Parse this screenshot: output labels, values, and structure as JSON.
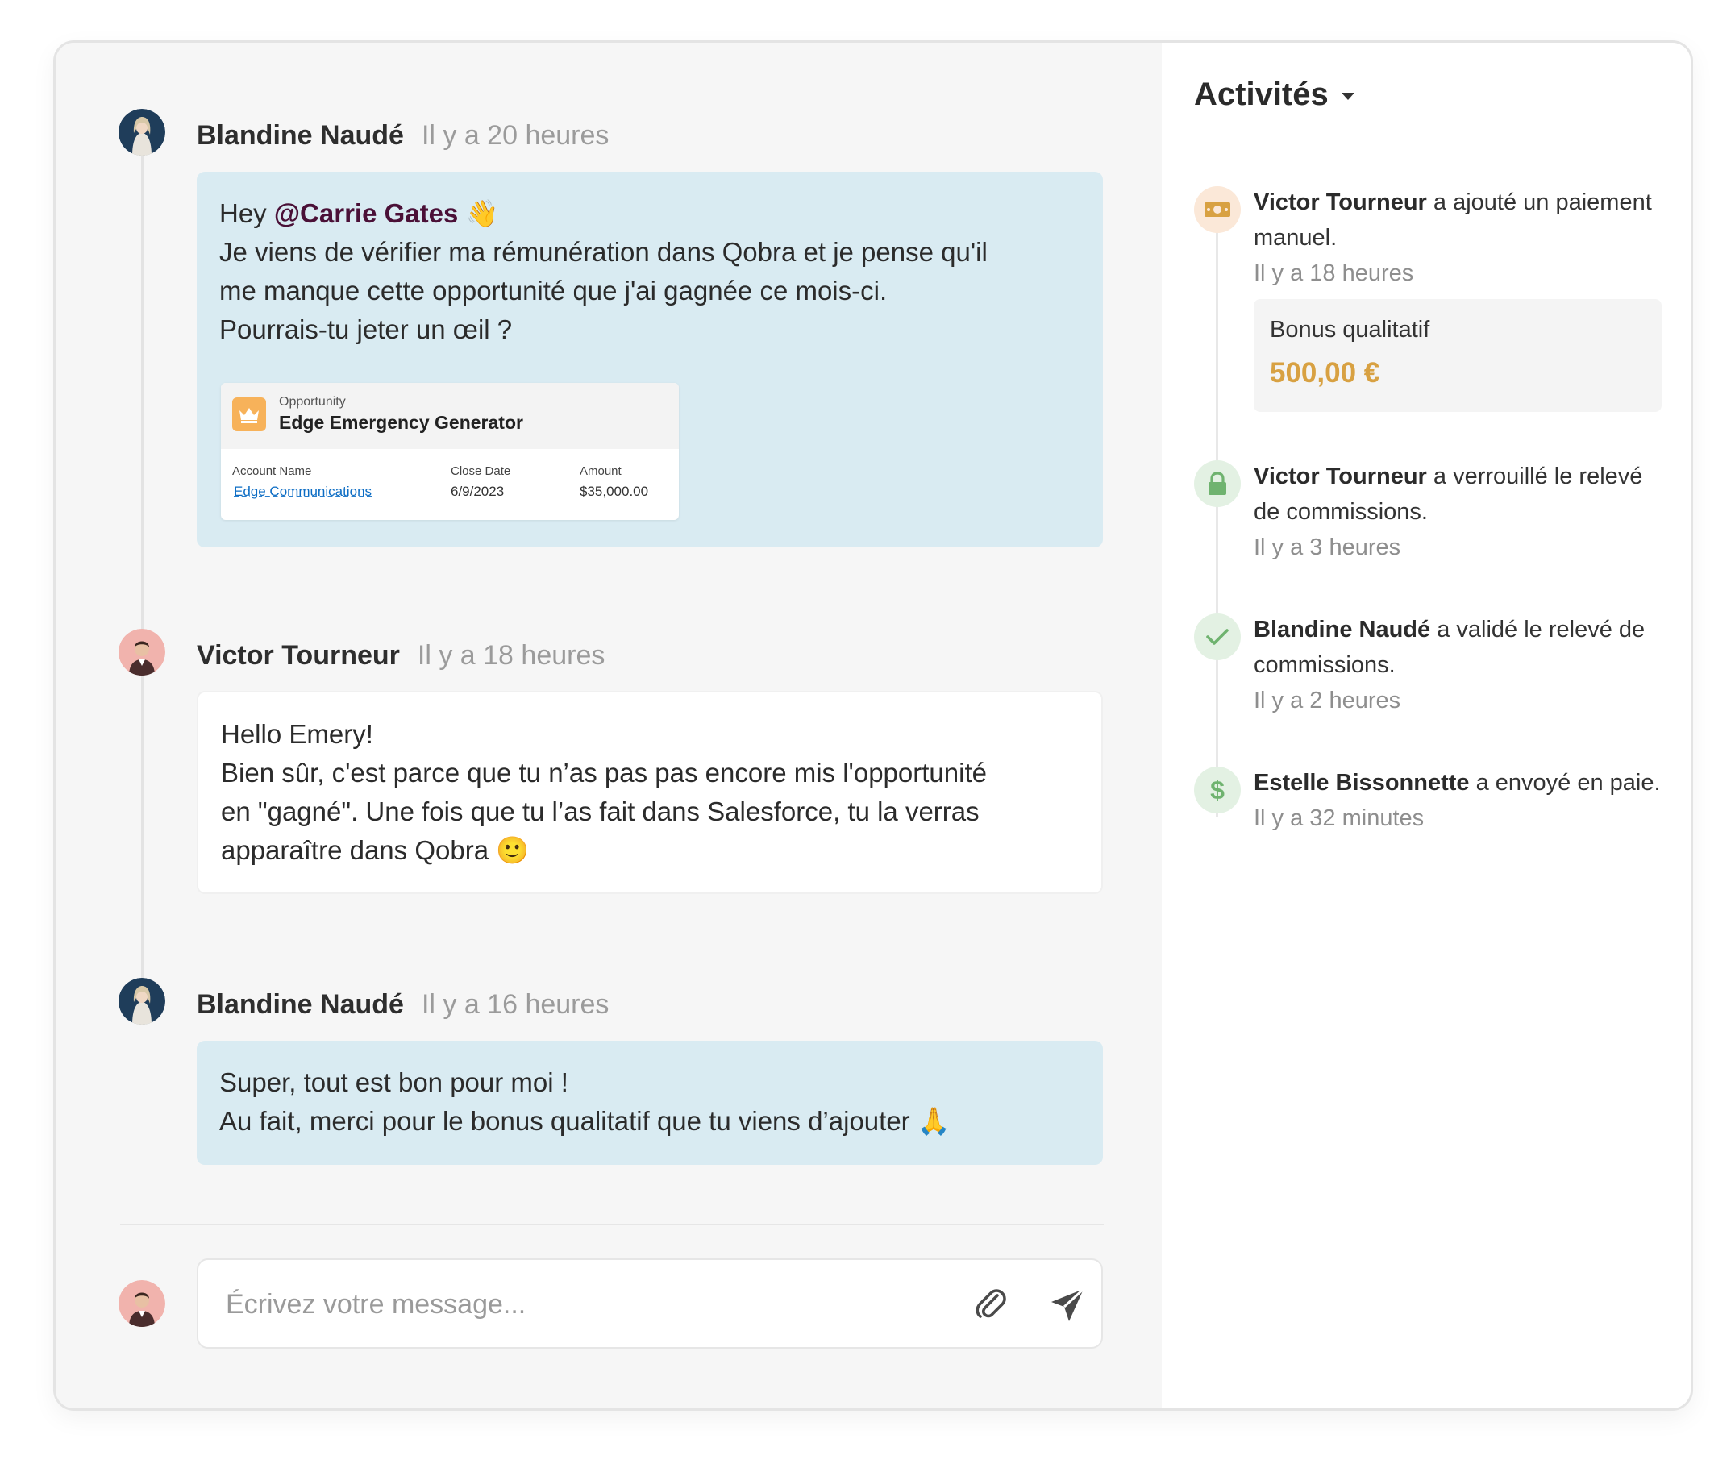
{
  "messages": [
    {
      "author": "Blandine Naudé",
      "time": "Il y a 20 heures",
      "greeting": "Hey ",
      "mention": "@Carrie Gates",
      "emoji": "👋",
      "lines": [
        "Je viens de vérifier ma rémunération dans Qobra et je pense qu'il",
        "me manque cette opportunité que j'ai gagnée ce mois-ci.",
        "Pourrais-tu jeter un œil ?"
      ],
      "opportunity": {
        "type_label": "Opportunity",
        "name": "Edge Emergency Generator",
        "col1_label": "Account Name",
        "col1_value": "Edge Communications",
        "col2_label": "Close Date",
        "col2_value": "6/9/2023",
        "col3_label": "Amount",
        "col3_value": "$35,000.00"
      }
    },
    {
      "author": "Victor Tourneur",
      "time": "Il y a 18 heures",
      "lines": [
        "Hello Emery!",
        "Bien sûr, c'est parce que tu n’as pas pas encore mis l'opportunité",
        "en \"gagné\". Une fois que tu l’as fait dans Salesforce, tu la verras",
        "apparaître dans Qobra 🙂"
      ]
    },
    {
      "author": "Blandine Naudé",
      "time": "Il y a 16 heures",
      "lines": [
        "Super, tout est bon pour moi !",
        "Au fait, merci pour le bonus qualitatif que tu viens d’ajouter 🙏"
      ]
    }
  ],
  "composer": {
    "placeholder": "Écrivez votre message..."
  },
  "activities": {
    "title": "Activités",
    "items": [
      {
        "actor": "Victor Tourneur",
        "action": " a ajouté un paiement manuel.",
        "time": "Il y a 18 heures",
        "icon": "money-icon",
        "bonus_label": "Bonus qualitatif",
        "bonus_amount": "500,00 €"
      },
      {
        "actor": "Victor Tourneur",
        "action": " a verrouillé le relevé de commissions.",
        "time": "Il y a 3 heures",
        "icon": "lock-icon"
      },
      {
        "actor": "Blandine Naudé",
        "action": " a validé le relevé de commissions.",
        "time": "Il y a 2 heures",
        "icon": "check-icon"
      },
      {
        "actor": "Estelle Bissonnette",
        "action": " a envoyé en paie.",
        "time": "Il y a 32 minutes",
        "icon": "dollar-icon"
      }
    ]
  },
  "colors": {
    "mention": "#4a1037",
    "bubble_blue": "#d9ebf2",
    "bonus_amount": "#d8a142",
    "money_icon_bg": "#fbe8d8",
    "green_icon_bg": "#e3f1e3",
    "green_icon": "#6fb36f"
  }
}
